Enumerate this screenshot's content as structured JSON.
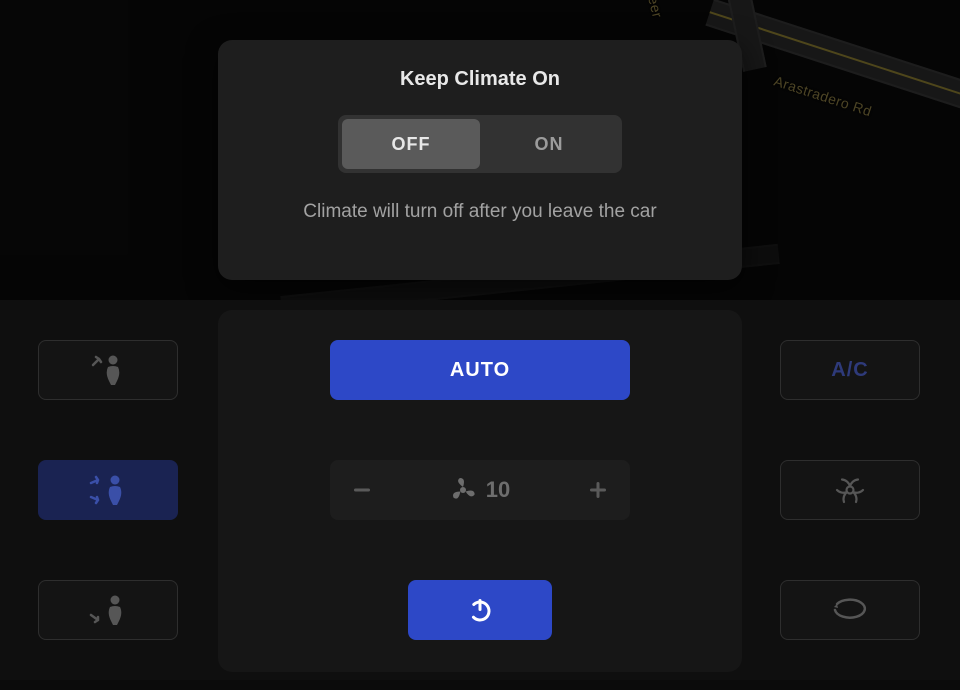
{
  "map": {
    "road1_label": "Deer",
    "road2_label": "Arastradero Rd"
  },
  "popup": {
    "title": "Keep Climate On",
    "off_label": "OFF",
    "on_label": "ON",
    "selected": "OFF",
    "description": "Climate will turn off after you leave the car"
  },
  "climate": {
    "auto_label": "AUTO",
    "ac_label": "A/C",
    "fan_speed": "10",
    "airflow": {
      "face": false,
      "face_feet": true,
      "feet": false
    },
    "biohazard_on": false,
    "recirc_on": false,
    "power_on": true
  },
  "colors": {
    "accent": "#2d48c7",
    "muted_icon": "#565656"
  }
}
